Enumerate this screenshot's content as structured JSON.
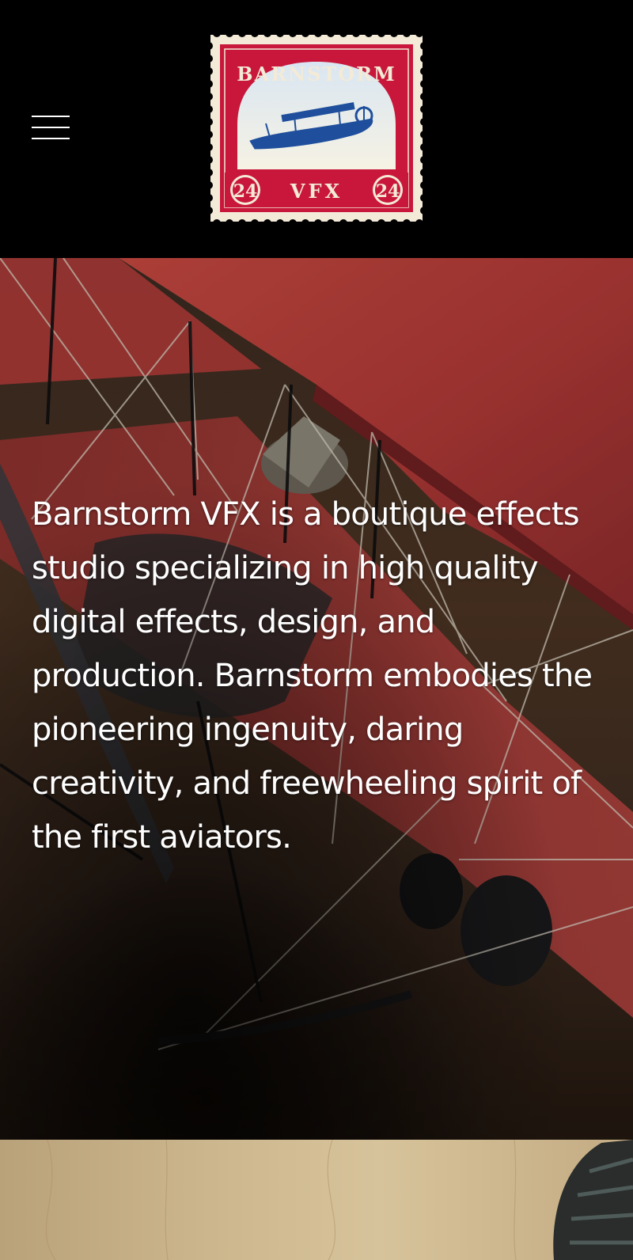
{
  "header": {
    "menu_icon": "hamburger-menu-icon",
    "logo": {
      "top_text": "BARNSTORM",
      "bottom_text": "VFX",
      "left_value": "24",
      "right_value": "24",
      "colors": {
        "frame": "#c8173a",
        "paper": "#f3ead7",
        "plane": "#1f4f9c"
      }
    }
  },
  "hero": {
    "description": "Barnstorm VFX is a boutique effects studio specializing in high quality digital effects, design, and production. Barnstorm embodies the pioneering ingenuity, daring creativity, and freewheeling spirit of the first aviators."
  },
  "colors": {
    "header_background": "#000000",
    "text": "#ffffff",
    "wing_red": "#b8393a"
  }
}
